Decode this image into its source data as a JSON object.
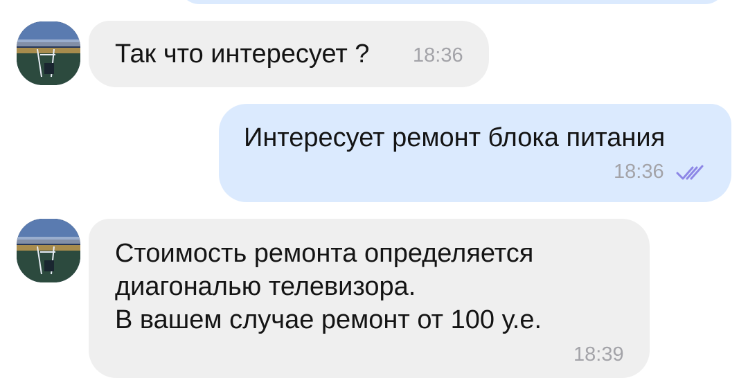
{
  "messages": [
    {
      "direction": "incoming",
      "text": "Так что интересует ?",
      "time": "18:36"
    },
    {
      "direction": "outgoing",
      "text": "Интересует ремонт блока питания",
      "time": "18:36",
      "status_icon": "double-check-icon"
    },
    {
      "direction": "incoming",
      "text": "Стоимость ремонта определяется\nдиагональю телевизора.\nВ вашем случае ремонт от 100 у.е.",
      "time": "18:39"
    }
  ],
  "colors": {
    "incoming_bubble": "#efefef",
    "outgoing_bubble": "#dbeafe",
    "time_text": "#a3a3a8",
    "read_check": "#8d87e6"
  }
}
